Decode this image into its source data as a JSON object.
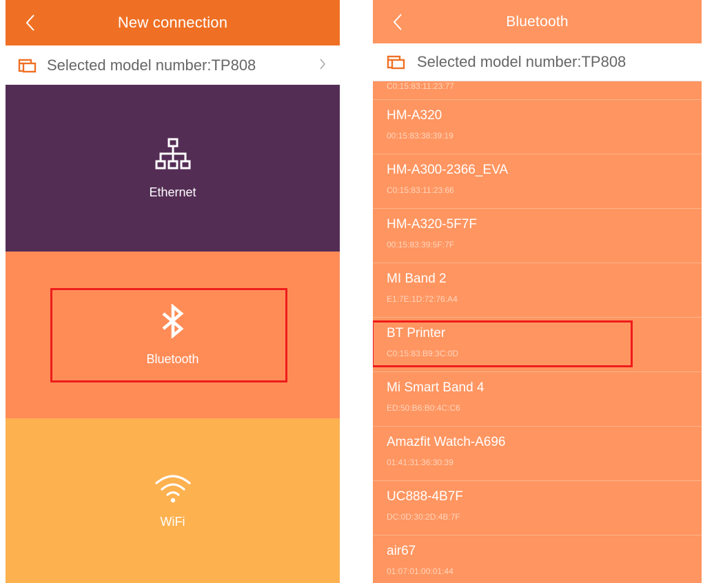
{
  "left_screen": {
    "title": "New connection",
    "model_label": "Selected model number:TP808",
    "tiles": [
      {
        "label": "Ethernet",
        "icon": "ethernet-network-icon",
        "color": "#542d55"
      },
      {
        "label": "Bluetooth",
        "icon": "bluetooth-icon",
        "color": "#ff8c57"
      },
      {
        "label": "WiFi",
        "icon": "wifi-icon",
        "color": "#fdb14f"
      }
    ]
  },
  "right_screen": {
    "title": "Bluetooth",
    "model_label": "Selected model number:TP808",
    "devices": [
      {
        "name": "",
        "address": "C0:15:83:11:23:77"
      },
      {
        "name": "HM-A320",
        "address": "00:15:83:38:39:19"
      },
      {
        "name": "HM-A300-2366_EVA",
        "address": "C0:15:83:11:23:66"
      },
      {
        "name": "HM-A320-5F7F",
        "address": "00:15:83:39:5F:7F"
      },
      {
        "name": "MI Band 2",
        "address": "E1:7E:1D:72:76:A4"
      },
      {
        "name": "BT Printer",
        "address": "C0:15:83:B9:3C:0D"
      },
      {
        "name": "Mi Smart Band 4",
        "address": "ED:50:B6:B0:4C:C6"
      },
      {
        "name": "Amazfit Watch-A696",
        "address": "01:41:31:36:30:39"
      },
      {
        "name": "UC888-4B7F",
        "address": "DC:0D:30:2D:4B:7F"
      },
      {
        "name": "air67",
        "address": "01:07:01:00:01:44"
      }
    ]
  },
  "colors": {
    "header_left": "#ef7024",
    "header_right": "#ff9560",
    "highlight": "#ee1c1c",
    "model_icon": "#ef7024"
  }
}
